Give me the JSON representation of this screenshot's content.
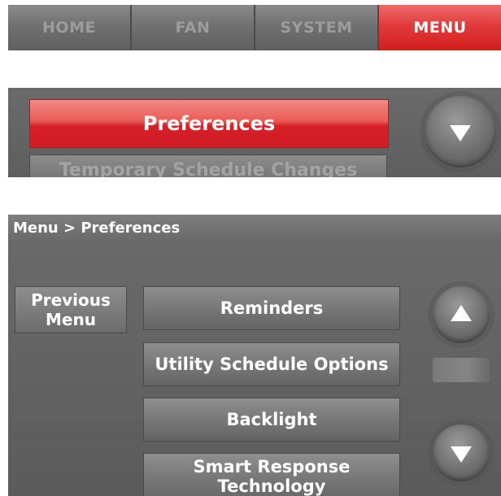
{
  "nav": {
    "tabs": [
      {
        "label": "HOME",
        "active": false
      },
      {
        "label": "FAN",
        "active": false
      },
      {
        "label": "SYSTEM",
        "active": false
      },
      {
        "label": "MENU",
        "active": true
      }
    ]
  },
  "strip": {
    "selected_item": "Preferences",
    "next_item": "Temporary Schedule Changes",
    "scroll_down_icon": "triangle-down"
  },
  "screen": {
    "breadcrumb": "Menu > Preferences",
    "previous_menu": {
      "line1": "Previous",
      "line2": "Menu"
    },
    "items": [
      {
        "label": "Reminders"
      },
      {
        "label": "Utility Schedule Options"
      },
      {
        "label": "Backlight"
      },
      {
        "label": "Smart Response Technology"
      }
    ],
    "scroll_up_icon": "triangle-up",
    "scroll_down_icon": "triangle-down"
  },
  "colors": {
    "accent": "#d81f27",
    "panel": "#666666",
    "text": "#ffffff"
  }
}
